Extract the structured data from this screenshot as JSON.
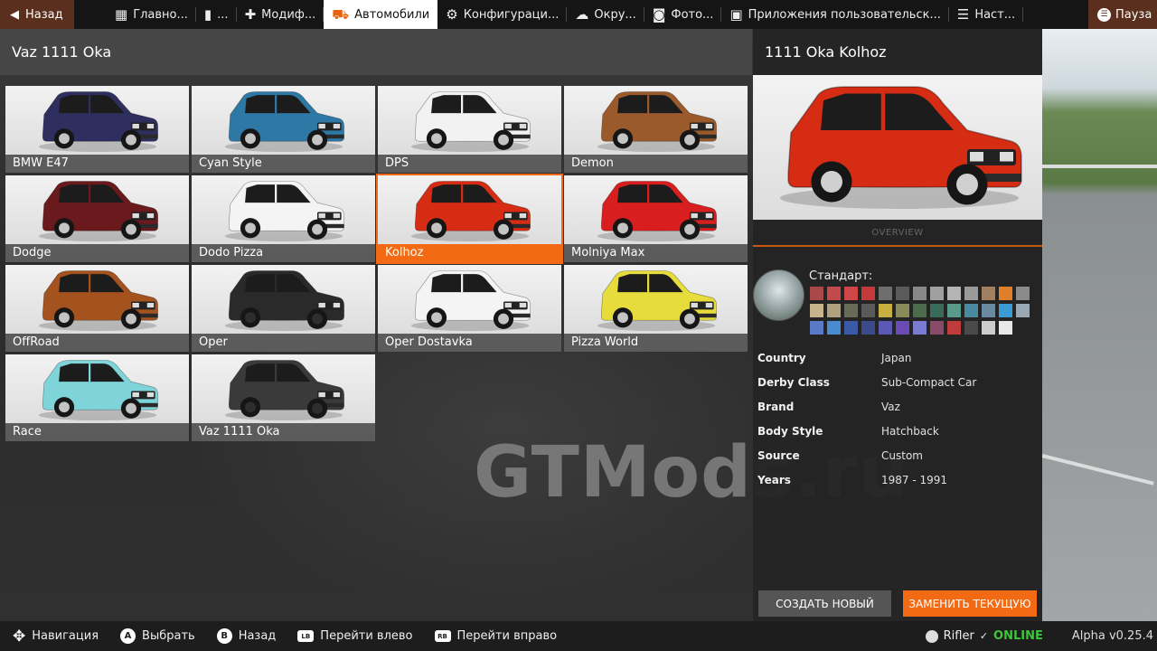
{
  "topbar": {
    "back_label": "Назад",
    "tabs": [
      {
        "label": "Главно...",
        "icon": "dashboard-icon"
      },
      {
        "label": "...",
        "icon": "map-icon"
      },
      {
        "label": "Модиф...",
        "icon": "puzzle-icon"
      },
      {
        "label": "Автомобили",
        "icon": "car-icon",
        "active": true
      },
      {
        "label": "Конфигураци...",
        "icon": "engine-icon"
      },
      {
        "label": "Окру...",
        "icon": "weather-icon"
      },
      {
        "label": "Фото...",
        "icon": "camera-icon"
      },
      {
        "label": "Приложения пользовательск...",
        "icon": "apps-icon"
      },
      {
        "label": "Наст...",
        "icon": "settings-icon"
      }
    ],
    "pause_label": "Пауза"
  },
  "left": {
    "title": "Vaz 1111 Oka",
    "configs": [
      {
        "label": "BMW E47",
        "color": "#2e2f5e"
      },
      {
        "label": "Cyan Style",
        "color": "#2e78a6"
      },
      {
        "label": "DPS",
        "color": "#f2f2f2"
      },
      {
        "label": "Demon",
        "color": "#9a5a2c"
      },
      {
        "label": "Dodge",
        "color": "#6a1a1c"
      },
      {
        "label": "Dodo Pizza",
        "color": "#f4f4f4"
      },
      {
        "label": "Kolhoz",
        "color": "#d62c14",
        "selected": true
      },
      {
        "label": "Molniya Max",
        "color": "#d81e1e"
      },
      {
        "label": "OffRoad",
        "color": "#a4521e"
      },
      {
        "label": "Oper",
        "color": "#2a2a2a"
      },
      {
        "label": "Oper Dostavka",
        "color": "#f4f4f4"
      },
      {
        "label": "Pizza World",
        "color": "#e6dc3c"
      },
      {
        "label": "Race",
        "color": "#7ed4d8"
      },
      {
        "label": "Vaz 1111 Oka",
        "color": "#3a3a3a"
      }
    ]
  },
  "right": {
    "title": "1111 Oka Kolhoz",
    "preview_color": "#d62c14",
    "overview_tab": "OVERVIEW",
    "paint_label": "Стандарт:",
    "swatches": [
      "#a84848",
      "#c24a4a",
      "#d04646",
      "#c43a3a",
      "#6e6e6e",
      "#5a5a5a",
      "#888888",
      "#a0a0a0",
      "#b4b4b4",
      "#9a9a9a",
      "#a08060",
      "#e07f2a",
      "#8a8a8a",
      "#c8b48c",
      "#b0a080",
      "#6a6a5a",
      "#5a5a5a",
      "#c8b040",
      "#8a8a58",
      "#4c6a4c",
      "#3a6a5a",
      "#5a9a8a",
      "#4a8aa0",
      "#6a8aa0",
      "#3c9ad4",
      "#9aa8b4",
      "#5a7ac8",
      "#4a8ad0",
      "#3a5aa8",
      "#3a4a8a",
      "#5a5ab4",
      "#6a4ab4",
      "#7a7ad0",
      "#8a4a6a",
      "#c03c3c",
      "#4a4a4a",
      "#cccccc",
      "#e8e8e8"
    ],
    "info": [
      {
        "key": "Country",
        "value": "Japan"
      },
      {
        "key": "Derby Class",
        "value": "Sub-Compact Car"
      },
      {
        "key": "Brand",
        "value": "Vaz"
      },
      {
        "key": "Body Style",
        "value": "Hatchback"
      },
      {
        "key": "Source",
        "value": "Custom"
      },
      {
        "key": "Years",
        "value": "1987 - 1991"
      }
    ],
    "create_label": "СОЗДАТЬ НОВЫЙ",
    "replace_label": "ЗАМЕНИТЬ ТЕКУЩУЮ"
  },
  "watermark": "GTMods.ru",
  "bottombar": {
    "hints": [
      {
        "button": "✥",
        "label": "Навигация",
        "icon": "dpad-icon"
      },
      {
        "button": "A",
        "label": "Выбрать",
        "icon": "a-button-icon"
      },
      {
        "button": "B",
        "label": "Назад",
        "icon": "b-button-icon"
      },
      {
        "button": "LB",
        "label": "Перейти влево",
        "icon": "lb-button-icon"
      },
      {
        "button": "RB",
        "label": "Перейти вправо",
        "icon": "rb-button-icon"
      }
    ],
    "user": "Rifler",
    "online": "ONLINE",
    "version": "Alpha v0.25.4"
  }
}
